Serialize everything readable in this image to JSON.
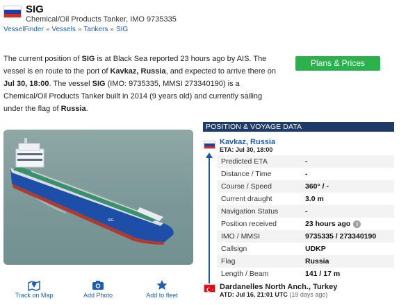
{
  "header": {
    "title": "SIG",
    "subtitle": "Chemical/Oil Products Tanker, IMO 9735335",
    "breadcrumb": [
      "VesselFinder",
      "Vessels",
      "Tankers",
      "SIG"
    ],
    "breadcrumb_sep": "»"
  },
  "description": {
    "p1": "The current position of ",
    "name": "SIG",
    "p2": " is at Black Sea reported 23 hours ago by AIS. The vessel is en route to the port of ",
    "port": "Kavkaz, Russia",
    "p3": ", and expected to arrive there on ",
    "arrival": "Jul 30, 18:00",
    "p4": ". The vessel ",
    "name2": "SIG",
    "p5": " (IMO: 9735335, MMSI 273340190) is a Chemical/Oil Products Tanker built in 2014 (9 years old) and currently sailing under the flag of ",
    "flag": "Russia",
    "p6": "."
  },
  "plans_button": "Plans & Prices",
  "actions": [
    {
      "label": "Track on Map",
      "icon": "map-pin-icon"
    },
    {
      "label": "Add Photo",
      "icon": "camera-icon"
    },
    {
      "label": "Add to fleet",
      "icon": "star-icon"
    }
  ],
  "voyage": {
    "header": "POSITION & VOYAGE DATA",
    "destination": "Kavkaz, Russia",
    "eta": "ETA: Jul 30, 18:00",
    "rows": [
      {
        "key": "Predicted ETA",
        "value": "-"
      },
      {
        "key": "Distance / Time",
        "value": "-"
      },
      {
        "key": "Course / Speed",
        "value": "360° / -"
      },
      {
        "key": "Current draught",
        "value": "3.0 m"
      },
      {
        "key": "Navigation Status",
        "value": "-"
      },
      {
        "key": "Position received",
        "value": "23 hours ago"
      },
      {
        "key": "IMO / MMSI",
        "value": "9735335 / 273340190"
      },
      {
        "key": "Callsign",
        "value": "UDKP"
      },
      {
        "key": "Flag",
        "value": "Russia"
      },
      {
        "key": "Length / Beam",
        "value": "141 / 17 m"
      }
    ],
    "origin": "Dardanelles North Anch., Turkey",
    "atd": "ATD: Jul 16, 21:01 UTC",
    "atd_ago": "(19 days ago)"
  },
  "colors": {
    "link": "#1a5fb4",
    "button_green": "#2bb24c",
    "panel_header": "#1e3a66",
    "ship_hull": "#1d4fa8",
    "ship_deck": "#3a8f6e"
  }
}
